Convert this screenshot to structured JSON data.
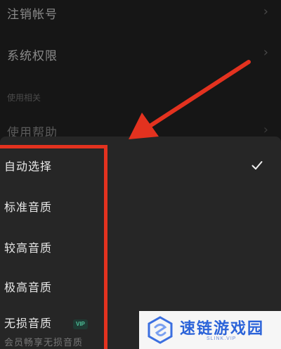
{
  "settings": {
    "rows": [
      {
        "label": "注销帐号"
      },
      {
        "label": "系统权限"
      }
    ],
    "section_header": "使用相关",
    "help_row": {
      "label": "使用帮助"
    }
  },
  "sheet": {
    "options": [
      {
        "label": "自动选择",
        "selected": true
      },
      {
        "label": "标准音质"
      },
      {
        "label": "较高音质"
      },
      {
        "label": "极高音质"
      },
      {
        "label": "无损音质",
        "badge": "VIP",
        "sub": "会员畅享无损音质"
      }
    ]
  },
  "annotation": {
    "color": "#e3321f"
  },
  "watermark": {
    "title": "速链游戏园",
    "subtitle": "SLINK.VIP"
  }
}
